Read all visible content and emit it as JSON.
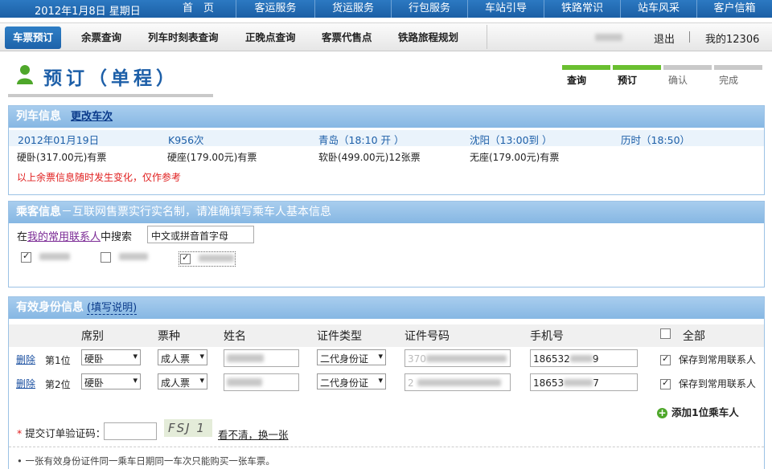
{
  "top": {
    "date": "2012年1月8日 星期日",
    "nav": [
      "首　页",
      "客运服务",
      "货运服务",
      "行包服务",
      "车站引导",
      "铁路常识",
      "站车风采",
      "客户信箱"
    ]
  },
  "subnav": {
    "tabs": [
      "车票预订",
      "余票查询",
      "列车时刻表查询",
      "正晚点查询",
      "客票代售点",
      "铁路旅程规划"
    ],
    "logout": "退出",
    "my": "我的12306"
  },
  "page": {
    "title": "预订（单程）"
  },
  "steps": [
    "查询",
    "预订",
    "确认",
    "完成"
  ],
  "train": {
    "header": "列车信息",
    "change_link": "更改车次",
    "date": "2012年01月19日",
    "train_no": "K956次",
    "from": "青岛（18:10 开 ）",
    "to": "沈阳（13:00到 ）",
    "duration": "历时（18:50）",
    "seats": [
      "硬卧(317.00元)有票",
      "硬座(179.00元)有票",
      "软卧(499.00元)12张票",
      "无座(179.00元)有票"
    ],
    "warning": "以上余票信息随时发生变化，仅作参考"
  },
  "passengers": {
    "header": "乘客信息",
    "header_note": "－互联网售票实行实名制，请准确填写乘车人基本信息",
    "search_prefix": "在",
    "search_link": "我的常用联系人",
    "search_suffix": "中搜索",
    "search_placeholder": "中文或拼音首字母"
  },
  "id_info": {
    "header": "有效身份信息",
    "help_link": "(填写说明)",
    "columns": [
      "席别",
      "票种",
      "姓名",
      "证件类型",
      "证件号码",
      "手机号"
    ],
    "all_label": "全部",
    "rows": [
      {
        "del": "删除",
        "pos": "第1位",
        "seat": "硬卧",
        "ticket": "成人票",
        "id_type": "二代身份证",
        "id_prefix": "370",
        "phone_prefix": "186532",
        "phone_suffix": "9",
        "save": "保存到常用联系人"
      },
      {
        "del": "删除",
        "pos": "第2位",
        "seat": "硬卧",
        "ticket": "成人票",
        "id_type": "二代身份证",
        "id_prefix": "2",
        "phone_prefix": "18653",
        "phone_suffix": "7",
        "save": "保存到常用联系人"
      }
    ],
    "add_label": "添加1位乘车人",
    "verify_star": "*",
    "verify_label": "提交订单验证码：",
    "captcha_text": "FSJ 1",
    "refresh_link": "看不清，换一张",
    "note": "• 一张有效身份证件同一乘车日期同一车次只能购买一张车票。"
  },
  "colors": {
    "brand": "#1d5fa8",
    "header_bar": "#86b7e3",
    "step_on": "#6abf30",
    "warning": "#e02020"
  }
}
